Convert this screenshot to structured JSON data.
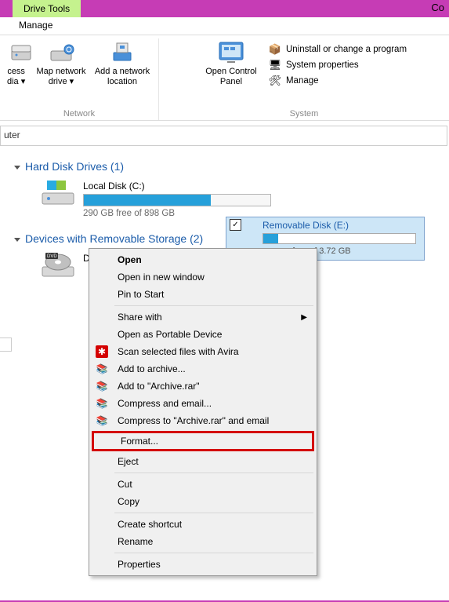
{
  "title_tab": "Drive Tools",
  "title_right": "Co",
  "menu_manage": "Manage",
  "ribbon": {
    "network": {
      "title": "Network",
      "access": {
        "line1": "cess",
        "line2": "dia ▾"
      },
      "map": {
        "line1": "Map network",
        "line2": "drive ▾"
      },
      "add": {
        "line1": "Add a network",
        "line2": "location"
      }
    },
    "system": {
      "title": "System",
      "open": {
        "line1": "Open Control",
        "line2": "Panel"
      },
      "uninstall": "Uninstall or change a program",
      "props": "System properties",
      "manage": "Manage"
    }
  },
  "breadcrumb": "uter",
  "sections": {
    "hdd": {
      "title": "Hard Disk Drives (1)",
      "drive": {
        "name": "Local Disk (C:)",
        "free": "290 GB free of 898 GB",
        "pct": 68
      }
    },
    "removable": {
      "title": "Devices with Removable Storage (2)",
      "dvd": "DVD RW Drive (D:)",
      "usb": {
        "name": "Removable Disk (E:)",
        "free": "free of 3.72 GB",
        "pct": 10
      }
    }
  },
  "menu": {
    "open": "Open",
    "newwin": "Open in new window",
    "pin": "Pin to Start",
    "share": "Share with",
    "portable": "Open as Portable Device",
    "avira": "Scan selected files with Avira",
    "addarch": "Add to archive...",
    "addrar": "Add to \"Archive.rar\"",
    "compemail": "Compress and email...",
    "comprar": "Compress to \"Archive.rar\" and email",
    "format": "Format...",
    "eject": "Eject",
    "cut": "Cut",
    "copy": "Copy",
    "shortcut": "Create shortcut",
    "rename": "Rename",
    "props": "Properties"
  }
}
